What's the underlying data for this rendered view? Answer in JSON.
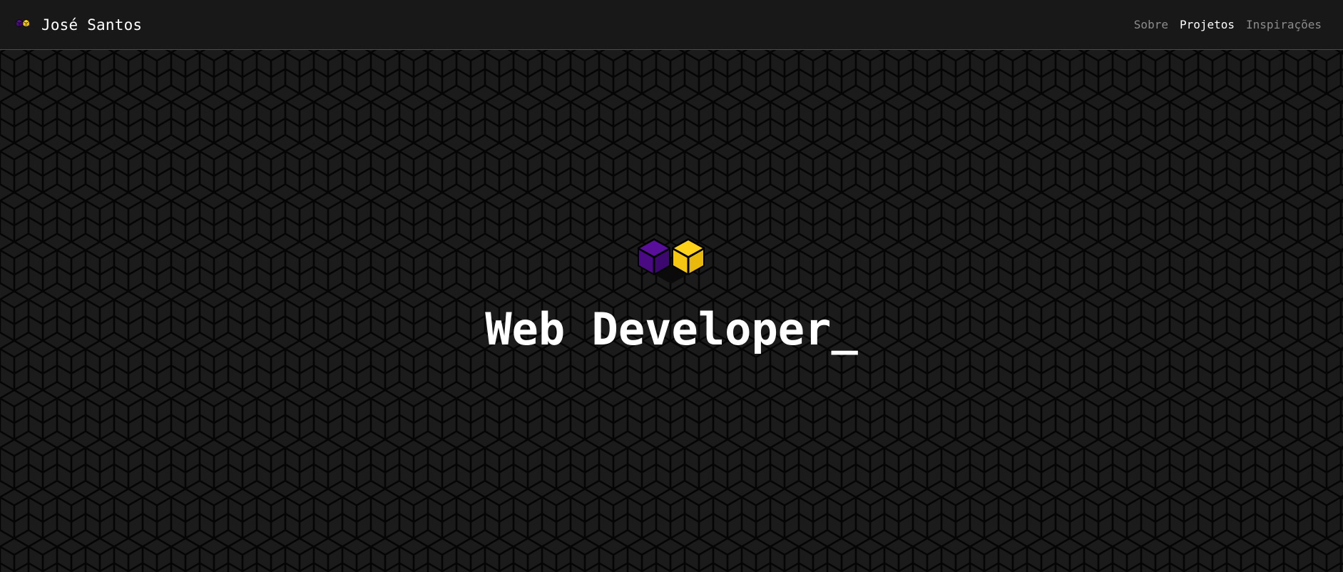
{
  "header": {
    "brand_name": "José Santos",
    "brand_icon": "cubes-logo-icon",
    "nav": [
      {
        "label": "Sobre",
        "active": false
      },
      {
        "label": "Projetos",
        "active": true
      },
      {
        "label": "Inspirações",
        "active": false
      }
    ]
  },
  "hero": {
    "logo_icon": "cubes-logo-icon",
    "title": "Web Developer",
    "cursor": "_"
  },
  "colors": {
    "background": "#1b1b1b",
    "header_background": "#181818",
    "cube_purple": "#5a0f9a",
    "cube_yellow": "#ffd21a",
    "nav_inactive": "#8c8c8c",
    "nav_active": "#ffffff"
  }
}
